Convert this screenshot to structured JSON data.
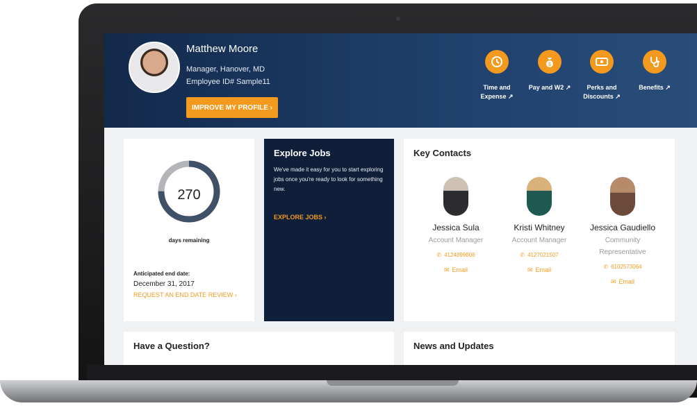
{
  "profile": {
    "name": "Matthew Moore",
    "title": "Manager, Hanover, MD",
    "employee_id": "Employee ID# Sample11",
    "improve_label": "IMPROVE MY PROFILE ›"
  },
  "shortcuts": [
    {
      "label1": "Time and",
      "label2": "Expense ↗",
      "icon": "clock-icon"
    },
    {
      "label1": "Pay and W2 ↗",
      "label2": "",
      "icon": "money-bag-icon"
    },
    {
      "label1": "Perks and",
      "label2": "Discounts ↗",
      "icon": "cash-icon"
    },
    {
      "label1": "Benefits ↗",
      "label2": "",
      "icon": "stethoscope-icon"
    }
  ],
  "assignment": {
    "days_value": "270",
    "days_label": "days remaining",
    "end_label": "Anticipated end date:",
    "end_date": "December 31, 2017",
    "review_link": "REQUEST AN END DATE REVIEW ›",
    "progress_fraction": 0.75
  },
  "explore_jobs": {
    "title": "Explore Jobs",
    "body": "We've made it easy for you to start exploring jobs once you're ready to look for something new.",
    "link": "EXPLORE JOBS ›"
  },
  "key_contacts": {
    "title": "Key Contacts",
    "contacts": [
      {
        "name": "Jessica Sula",
        "role": "Account Manager",
        "phone": "4124899806",
        "email": "Email"
      },
      {
        "name": "Kristi Whitney",
        "role": "Account Manager",
        "phone": "4127021507",
        "email": "Email"
      },
      {
        "name": "Jessica Gaudiello",
        "role": "Community Representative",
        "phone": "6102573064",
        "email": "Email"
      }
    ]
  },
  "question": {
    "title": "Have a Question?"
  },
  "news": {
    "title": "News and Updates"
  },
  "colors": {
    "accent": "#f39a1e",
    "header": "#13294b",
    "jobs_card": "#0f1f3a"
  }
}
